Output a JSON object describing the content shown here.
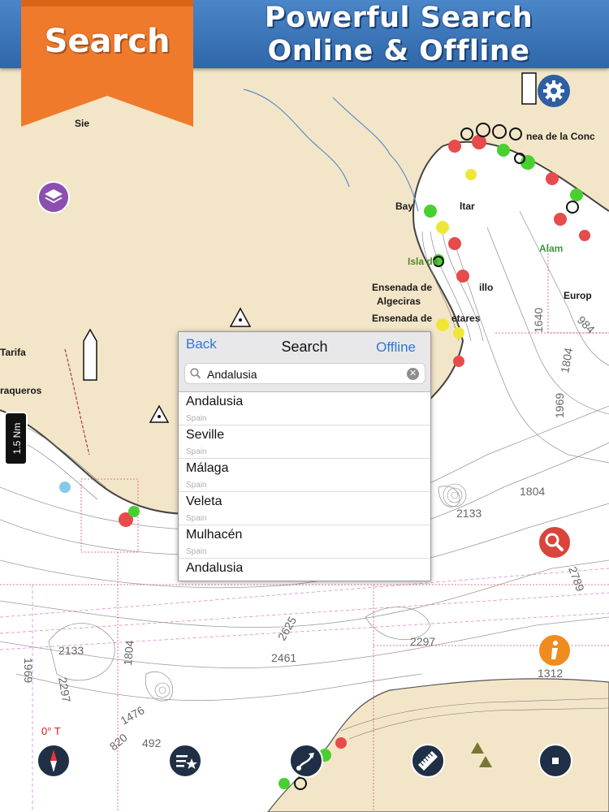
{
  "banner": {
    "ribbon_label": "Search",
    "title_line1": "Powerful Search",
    "title_line2": "Online & Offline"
  },
  "search_dialog": {
    "back_label": "Back",
    "title": "Search",
    "offline_label": "Offline",
    "query": "Andalusia",
    "results": [
      {
        "name": "Andalusia",
        "country": "Spain"
      },
      {
        "name": "Seville",
        "country": "Spain"
      },
      {
        "name": "Málaga",
        "country": "Spain"
      },
      {
        "name": "Veleta",
        "country": "Spain"
      },
      {
        "name": "Mulhacén",
        "country": "Spain"
      },
      {
        "name": "Andalusia",
        "country": ""
      }
    ]
  },
  "map": {
    "scale_label": "1.5 Nm",
    "compass_label": "0° T",
    "place_labels": [
      "Sie",
      "nea de la Conc",
      "Bay",
      "ltar",
      "Isla de",
      "Ensenada de",
      "illo",
      "Algeciras",
      "Ensenada de",
      "etares",
      "Alam",
      "Europ",
      "Tarifa",
      "raqueros"
    ],
    "depth_labels": [
      "2133",
      "1804",
      "2789",
      "2297",
      "1312",
      "2625",
      "2461",
      "2133",
      "2297",
      "1969",
      "1804",
      "1476",
      "820",
      "492",
      "1640",
      "984",
      "1969",
      "1804"
    ]
  },
  "colors": {
    "banner_blue": "#3a76bb",
    "ribbon_orange": "#f07a2c",
    "land": "#f3e6c8",
    "sea": "#ffffff",
    "link_blue": "#2f76d2",
    "search_button": "#d9443b",
    "info_button": "#f08c1e",
    "layers_button": "#8b4fb0"
  },
  "icons": [
    "gear-icon",
    "layers-icon",
    "search-icon",
    "info-icon",
    "compass-icon",
    "list-star-icon",
    "route-icon",
    "ruler-icon",
    "stop-icon"
  ]
}
